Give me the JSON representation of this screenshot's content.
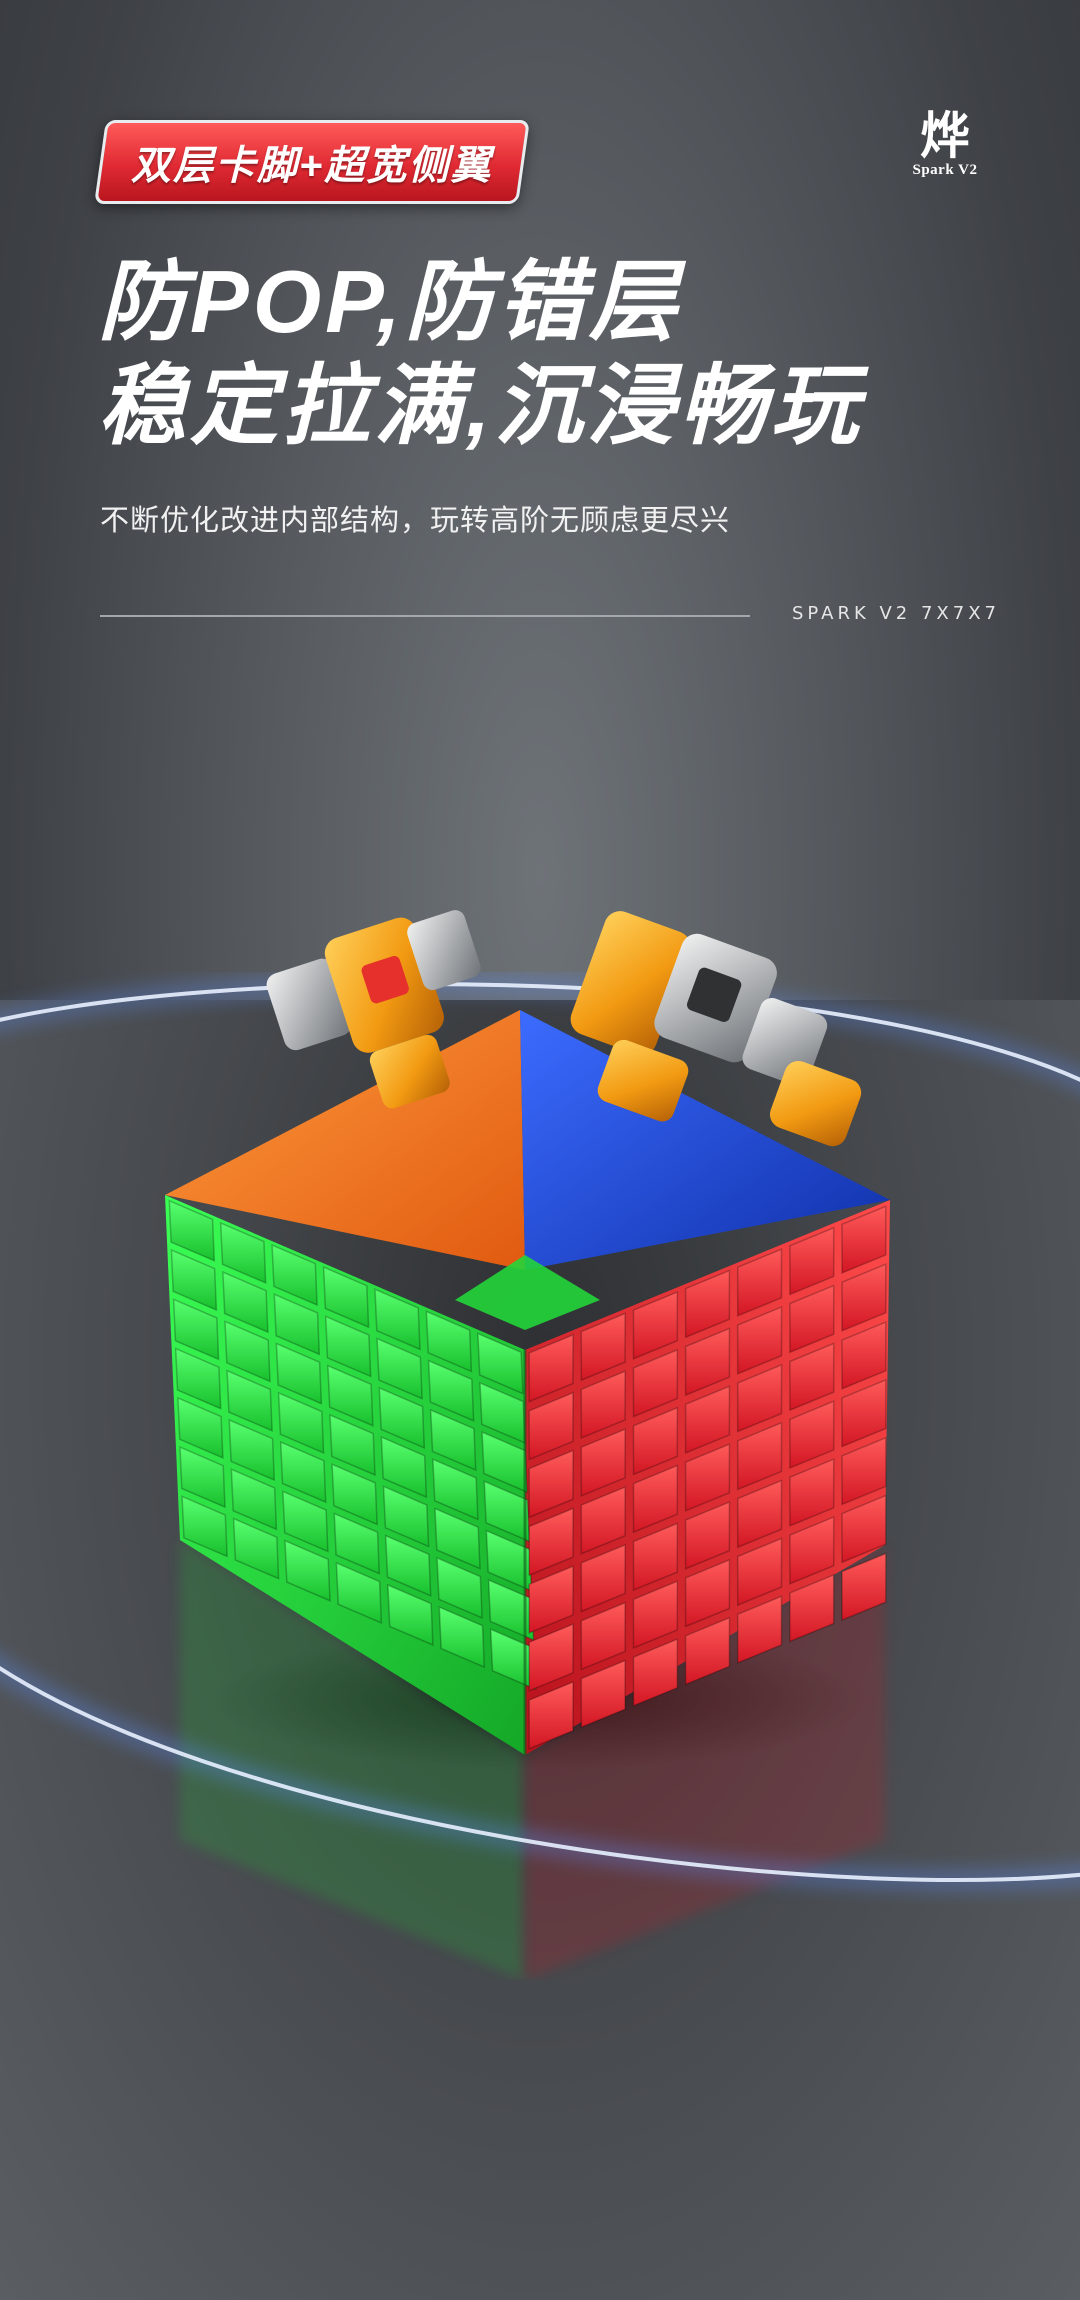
{
  "badge": {
    "label": "双层卡脚+超宽侧翼"
  },
  "logo": {
    "glyph": "烨",
    "wordmark": "Spark V2"
  },
  "headline": {
    "line1": "防POP,防错层",
    "line2": "稳定拉满,沉浸畅玩"
  },
  "subtitle": "不断优化改进内部结构，玩转高阶无顾虑更尽兴",
  "model": "SPARK V2 7X7X7",
  "colors": {
    "badge_red": "#e02a33",
    "cube_green": "#22d53a",
    "cube_red": "#e8202c",
    "cube_blue": "#1d4de0",
    "cube_orange": "#ff7a1c",
    "ring_glow": "#9fc4ff"
  }
}
